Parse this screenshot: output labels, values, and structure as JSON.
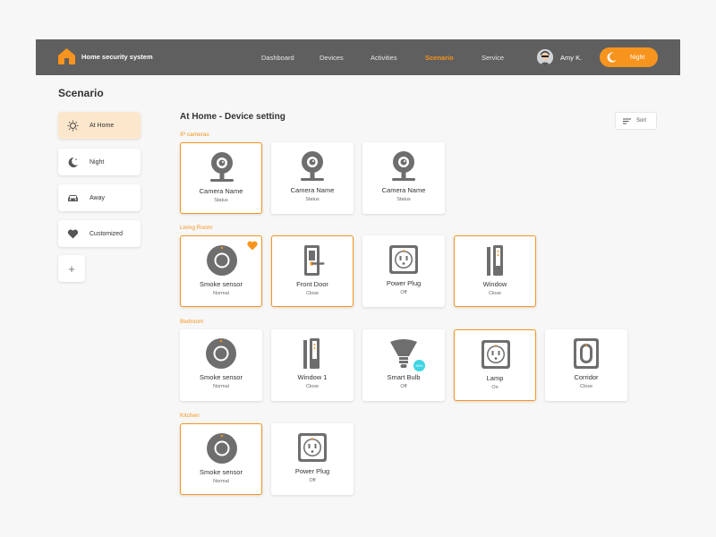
{
  "header": {
    "app_title": "Home security system",
    "nav": [
      {
        "label": "Dashboard",
        "active": false
      },
      {
        "label": "Devices",
        "active": false
      },
      {
        "label": "Activities",
        "active": false
      },
      {
        "label": "Scenario",
        "active": true
      },
      {
        "label": "Service",
        "active": false
      }
    ],
    "user_name": "Amy K.",
    "mode_label": "Night"
  },
  "page": {
    "title": "Scenario"
  },
  "scenarios": [
    {
      "label": "At Home",
      "icon": "sun-icon",
      "active": true
    },
    {
      "label": "Night",
      "icon": "moon-icon",
      "active": false
    },
    {
      "label": "Away",
      "icon": "car-icon",
      "active": false
    },
    {
      "label": "Customized",
      "icon": "heart-icon",
      "active": false
    }
  ],
  "add_label": "+",
  "main": {
    "title": "At Home - Device setting",
    "sort_label": "Sort",
    "groups": [
      {
        "label": "IP cameras",
        "devices": [
          {
            "name": "Camera Name",
            "status": "Status",
            "icon": "camera-icon",
            "selected": true
          },
          {
            "name": "Camera Name",
            "status": "Status",
            "icon": "camera-icon",
            "selected": false
          },
          {
            "name": "Camera Name",
            "status": "Status",
            "icon": "camera-icon",
            "selected": false
          }
        ]
      },
      {
        "label": "Living Room",
        "devices": [
          {
            "name": "Smoke sensor",
            "status": "Normal",
            "icon": "smoke-sensor-icon",
            "selected": true,
            "favorite": true
          },
          {
            "name": "Front Door",
            "status": "Close",
            "icon": "door-lock-icon",
            "selected": true
          },
          {
            "name": "Power Plug",
            "status": "Off",
            "icon": "power-plug-icon",
            "selected": false
          },
          {
            "name": "Window",
            "status": "Close",
            "icon": "window-sensor-icon",
            "selected": true
          }
        ]
      },
      {
        "label": "Bedroom",
        "devices": [
          {
            "name": "Smoke sensor",
            "status": "Normal",
            "icon": "smoke-sensor-icon",
            "selected": false
          },
          {
            "name": "Window 1",
            "status": "Close",
            "icon": "window-sensor-icon",
            "selected": false
          },
          {
            "name": "Smart Bulb",
            "status": "Off",
            "icon": "smart-bulb-icon",
            "selected": false,
            "badge": "80%"
          },
          {
            "name": "Lamp",
            "status": "On",
            "icon": "power-plug-icon",
            "selected": true
          },
          {
            "name": "Corridor",
            "status": "Close",
            "icon": "motion-sensor-icon",
            "selected": false
          }
        ]
      },
      {
        "label": "Kitchen",
        "devices": [
          {
            "name": "Smoke sensor",
            "status": "Normal",
            "icon": "smoke-sensor-icon",
            "selected": true
          },
          {
            "name": "Power Plug",
            "status": "Off",
            "icon": "power-plug-icon",
            "selected": false
          }
        ]
      }
    ]
  },
  "colors": {
    "accent": "#f7941d",
    "header_bg": "#5f5f5f",
    "icon_gray": "#6e6e6e",
    "badge": "#3fd5e3"
  }
}
